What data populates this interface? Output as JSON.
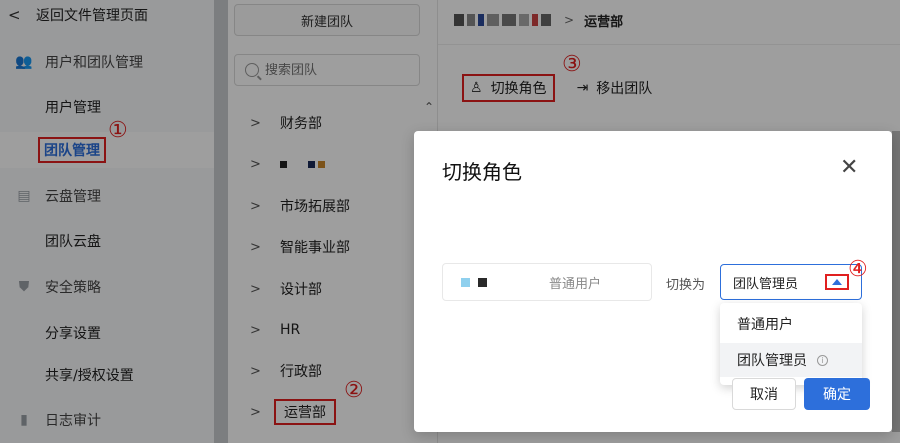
{
  "sidebar": {
    "back_label": "返回文件管理页面",
    "groups": [
      {
        "label": "用户和团队管理",
        "icon": "users-icon"
      },
      {
        "label": "云盘管理",
        "icon": "disk-icon"
      },
      {
        "label": "安全策略",
        "icon": "shield-icon"
      },
      {
        "label": "日志审计",
        "icon": "log-icon"
      }
    ],
    "items": {
      "user_mgmt": "用户管理",
      "team_mgmt": "团队管理",
      "team_disk": "团队云盘",
      "share_settings": "分享设置",
      "share_auth": "共享/授权设置"
    }
  },
  "teams": {
    "new_team_label": "新建团队",
    "search_placeholder": "搜索团队",
    "list": [
      "财务部",
      "",
      "市场拓展部",
      "智能事业部",
      "设计部",
      "HR",
      "行政部",
      "运营部"
    ]
  },
  "main": {
    "breadcrumb_current": "运营部",
    "switch_role_label": "切换角色",
    "move_out_label": "移出团队"
  },
  "modal": {
    "title": "切换角色",
    "current_role": "普通用户",
    "switch_to_label": "切换为",
    "selected_role": "团队管理员",
    "options": [
      "普通用户",
      "团队管理员"
    ],
    "cancel_label": "取消",
    "ok_label": "确定"
  },
  "annotations": [
    "①",
    "②",
    "③",
    "④"
  ],
  "colors": {
    "accent": "#2d6fdb",
    "highlight": "#e02020"
  }
}
